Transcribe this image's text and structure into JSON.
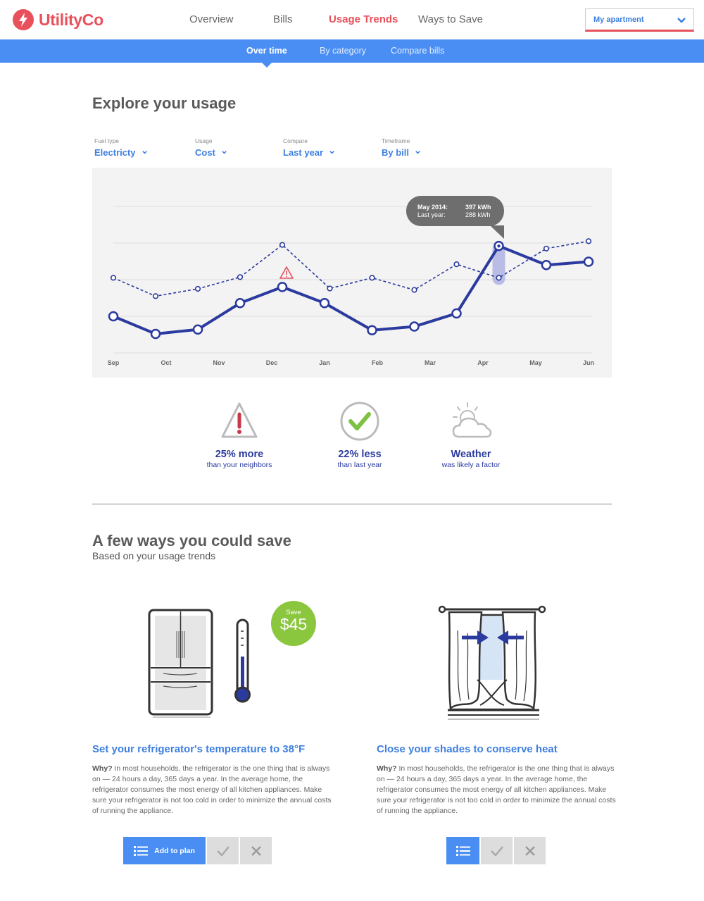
{
  "brand": {
    "name": "UtilityCo",
    "color": "#e8505b"
  },
  "nav": {
    "items": [
      {
        "label": "Overview"
      },
      {
        "label": "Bills"
      },
      {
        "label": "Usage Trends",
        "active": true
      },
      {
        "label": "Ways to Save"
      }
    ]
  },
  "account_select": {
    "value": "My apartment"
  },
  "subnav": {
    "items": [
      {
        "label": "Over time",
        "active": true
      },
      {
        "label": "By category"
      },
      {
        "label": "Compare bills"
      }
    ]
  },
  "explore": {
    "title": "Explore your usage"
  },
  "filters": [
    {
      "label": "Fuel type",
      "value": "Electricty"
    },
    {
      "label": "Usage",
      "value": "Cost"
    },
    {
      "label": "Compare",
      "value": "Last year"
    },
    {
      "label": "Timeframe",
      "value": "By bill"
    }
  ],
  "chart_data": {
    "type": "line",
    "categories": [
      "Sep",
      "Oct",
      "Nov",
      "Dec",
      "Jan",
      "Feb",
      "Mar",
      "Apr",
      "May",
      "Jun"
    ],
    "x": [
      0,
      1,
      2,
      2.8,
      3.6,
      4.2,
      5.2,
      6,
      6.8,
      7.4,
      8.2,
      9
    ],
    "series": [
      {
        "style": "solid",
        "color": "#2b3a9e",
        "x": [
          0,
          0.8,
          1.6,
          2.4,
          3.2,
          4.0,
          4.9,
          5.7,
          6.5,
          7.3,
          8.2,
          9
        ],
        "values": [
          1.0,
          0.52,
          0.64,
          1.36,
          1.8,
          1.36,
          0.62,
          0.72,
          1.08,
          2.92,
          2.4,
          2.49
        ]
      },
      {
        "style": "dashed",
        "color": "#2b3a9e",
        "x": [
          0,
          0.8,
          1.6,
          2.4,
          3.2,
          4.1,
          4.9,
          5.7,
          6.5,
          7.3,
          8.2,
          9
        ],
        "values": [
          2.05,
          1.55,
          1.75,
          2.07,
          2.95,
          1.76,
          2.05,
          1.72,
          2.42,
          2.05,
          2.85,
          3.05
        ]
      }
    ],
    "ylim": [
      0,
      4
    ],
    "grid": true,
    "tooltip": {
      "period": "May 2014:",
      "value": "397 kWh",
      "compare_label": "Last year:",
      "compare_value": "288 kWh"
    },
    "warning_at": "Dec"
  },
  "stats": [
    {
      "icon": "warning-icon",
      "main": "25% more",
      "sub": "than your neighbors"
    },
    {
      "icon": "check-icon",
      "main": "22% less",
      "sub": "than last year"
    },
    {
      "icon": "weather-icon",
      "main": "Weather",
      "sub": "was likely a factor"
    }
  ],
  "save": {
    "title": "A few ways you could save",
    "subtitle": "Based on your usage trends",
    "tips": [
      {
        "title": "Set your refrigerator's temperature to 38°F",
        "why": "Why?",
        "body": "In most households, the refrigerator is the one thing that is always on — 24 hours a day, 365 days a year. In the average home, the refrigerator consumes the most energy of all kitchen appliances. Make sure your refrigerator is not too cold in order to minimize the annual costs of running the appliance.",
        "badge_label": "Save",
        "badge_value": "$45",
        "add_label": "Add to plan"
      },
      {
        "title": "Close your shades to conserve heat",
        "why": "Why?",
        "body": "In most households, the refrigerator is the one thing that is always on — 24 hours a day, 365 days a year. In the average home, the refrigerator consumes the most energy of all kitchen appliances. Make sure your refrigerator is not too cold in order to minimize the annual costs of running the appliance."
      }
    ]
  },
  "colors": {
    "accent": "#4a8ef3",
    "dark_blue": "#2b3a9e",
    "green": "#8bc63f",
    "red": "#e8505b"
  }
}
